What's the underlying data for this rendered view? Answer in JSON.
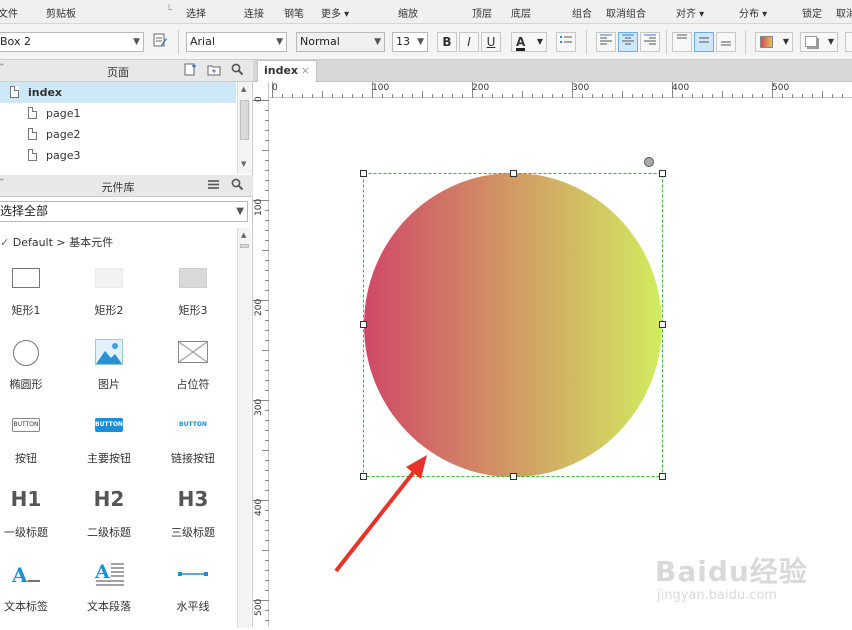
{
  "menu": {
    "items": [
      "文件",
      "剪贴板",
      "选择",
      "连接",
      "钢笔",
      "更多 ▾",
      "缩放",
      "顶层",
      "底层",
      "组合",
      "取消组合",
      "对齐 ▾",
      "分布 ▾",
      "锁定",
      "取消"
    ]
  },
  "format_bar": {
    "shape_name": "Box 2",
    "font_family": "Arial",
    "font_style": "Normal",
    "font_size": "13",
    "bold": "B",
    "italic": "I",
    "underline": "U",
    "font_color_label": "A"
  },
  "pages_panel": {
    "title": "页面",
    "items": [
      "index",
      "page1",
      "page2",
      "page3"
    ],
    "selected": "index"
  },
  "library_panel": {
    "title": "元件库",
    "filter_value": "选择全部",
    "breadcrumb": "Default > 基本元件",
    "widgets": [
      {
        "label": "矩形1",
        "icon": "rectangle-outline-icon"
      },
      {
        "label": "矩形2",
        "icon": "rectangle-light-icon"
      },
      {
        "label": "矩形3",
        "icon": "rectangle-gray-icon"
      },
      {
        "label": "椭圆形",
        "icon": "ellipse-icon"
      },
      {
        "label": "图片",
        "icon": "image-icon"
      },
      {
        "label": "占位符",
        "icon": "placeholder-icon"
      },
      {
        "label": "按钮",
        "icon": "button-icon",
        "glyph": "BUTTON"
      },
      {
        "label": "主要按钮",
        "icon": "primary-button-icon",
        "glyph": "BUTTON"
      },
      {
        "label": "链接按钮",
        "icon": "link-button-icon",
        "glyph": "BUTTON"
      },
      {
        "label": "一级标题",
        "icon": "heading1-icon",
        "glyph": "H1"
      },
      {
        "label": "二级标题",
        "icon": "heading2-icon",
        "glyph": "H2"
      },
      {
        "label": "三级标题",
        "icon": "heading3-icon",
        "glyph": "H3"
      },
      {
        "label": "文本标签",
        "icon": "text-label-icon"
      },
      {
        "label": "文本段落",
        "icon": "text-paragraph-icon"
      },
      {
        "label": "水平线",
        "icon": "horizontal-line-icon"
      }
    ]
  },
  "canvas": {
    "tab_label": "index",
    "tab_close": "×",
    "h_ruler_labels": [
      "0",
      "100",
      "200",
      "300",
      "400",
      "500"
    ],
    "v_ruler_labels": [
      "0",
      "100",
      "200",
      "300",
      "400",
      "500"
    ],
    "circle_gradient": {
      "start": "#d04868",
      "end": "#d2ec60"
    },
    "selection_color": "#33bb33",
    "arrow_color": "#e8332a"
  },
  "watermark": {
    "brand": "Baidu经验",
    "url": "jingyan.baidu.com"
  }
}
